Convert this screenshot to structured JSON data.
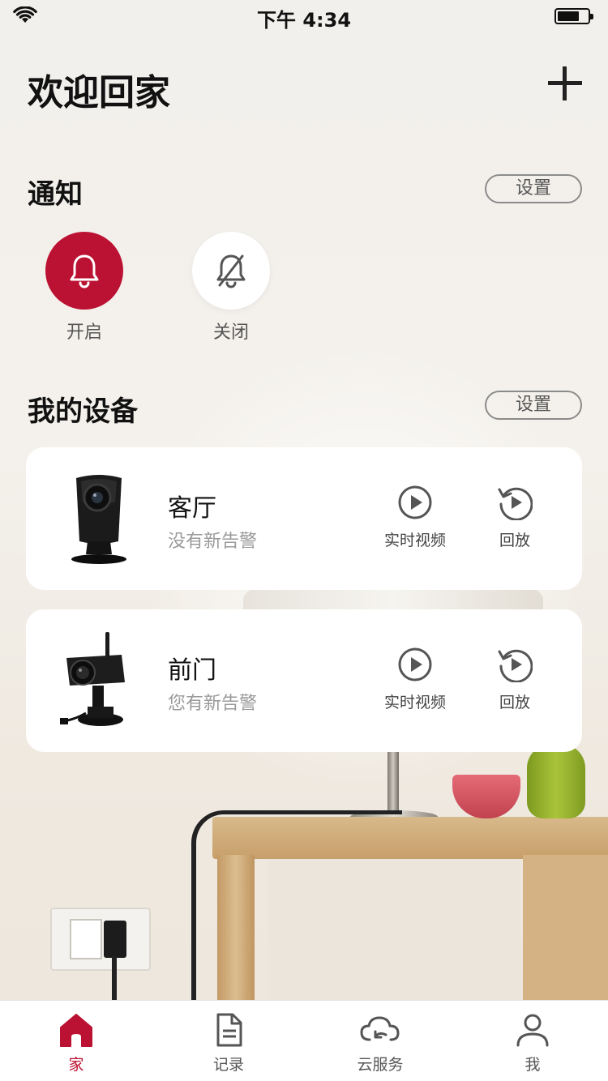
{
  "status_bar": {
    "time": "下午 4:34"
  },
  "header": {
    "title": "欢迎回家"
  },
  "notifications": {
    "title": "通知",
    "settings_label": "设置",
    "on_label": "开启",
    "off_label": "关闭"
  },
  "devices": {
    "title": "我的设备",
    "settings_label": "设置",
    "items": [
      {
        "name": "客厅",
        "status": "没有新告警",
        "live_label": "实时视频",
        "replay_label": "回放"
      },
      {
        "name": "前门",
        "status": "您有新告警",
        "live_label": "实时视频",
        "replay_label": "回放"
      }
    ]
  },
  "tabbar": {
    "items": [
      {
        "label": "家",
        "icon": "home-icon",
        "active": true
      },
      {
        "label": "记录",
        "icon": "document-icon",
        "active": false
      },
      {
        "label": "云服务",
        "icon": "cloud-icon",
        "active": false
      },
      {
        "label": "我",
        "icon": "user-icon",
        "active": false
      }
    ]
  },
  "colors": {
    "accent": "#bb1233",
    "card": "#ffffff",
    "muted_text": "#9a9a9a"
  }
}
